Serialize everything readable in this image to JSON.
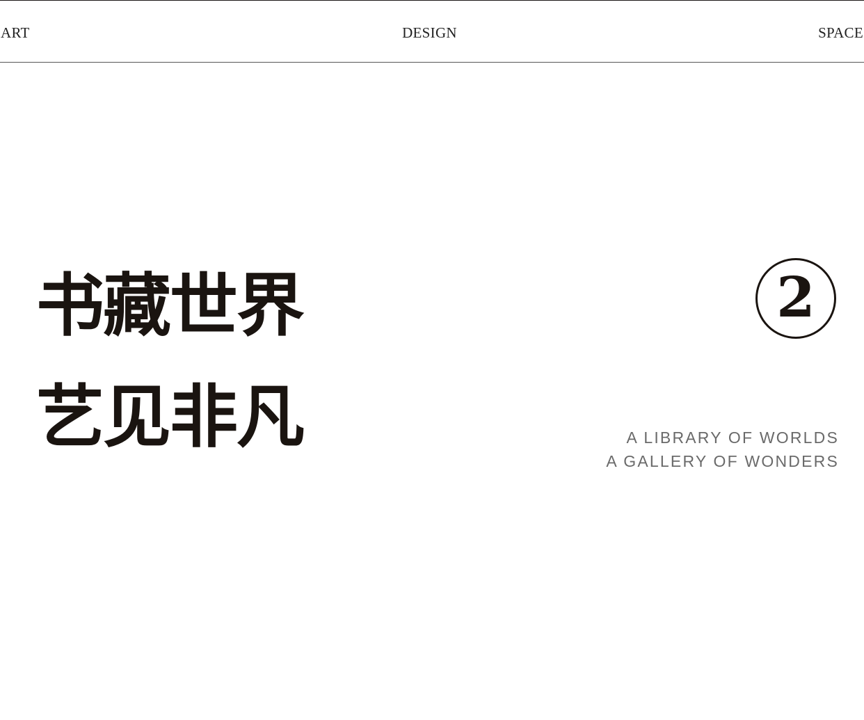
{
  "header": {
    "left": "ART",
    "center": "DESIGN",
    "right": "SPACE"
  },
  "title": {
    "line1": "书藏世界",
    "line2": "艺见非凡"
  },
  "badge": {
    "number": "2"
  },
  "tagline": {
    "line1": "A LIBRARY OF WORLDS",
    "line2": "A GALLERY OF WONDERS"
  },
  "colors": {
    "text": "#1a1410",
    "muted": "#6a6a6a",
    "background": "#ffffff"
  }
}
